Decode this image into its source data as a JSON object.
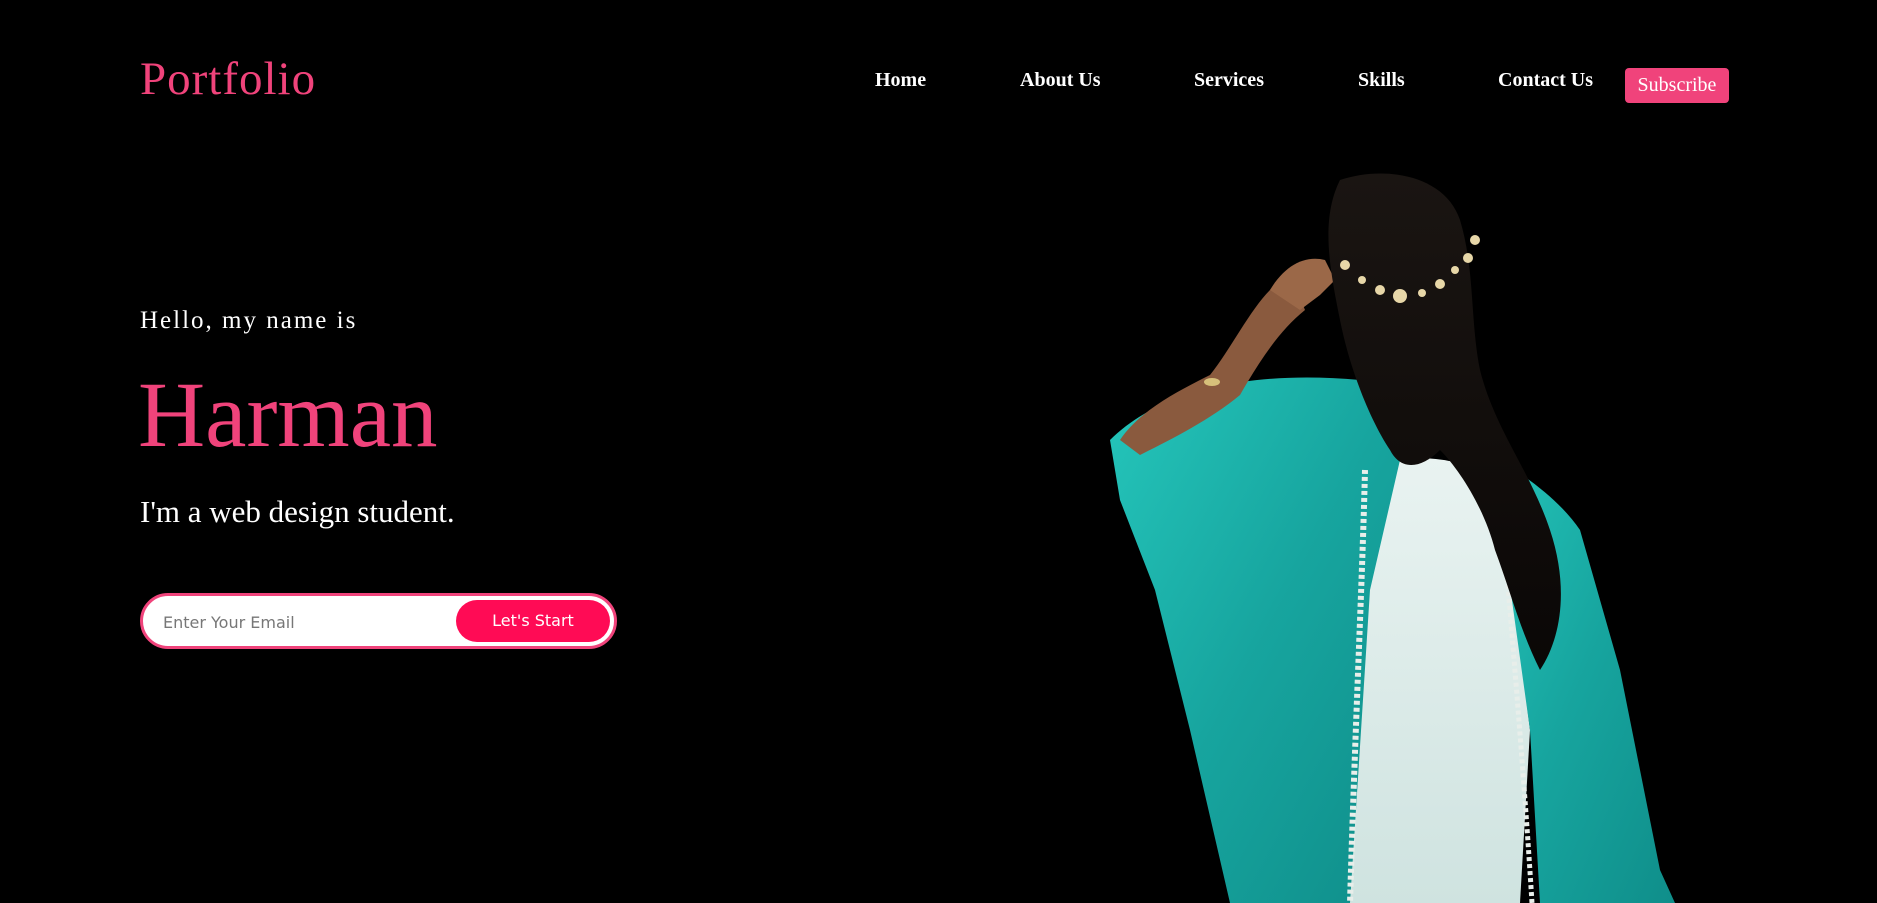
{
  "header": {
    "logo": "Portfolio",
    "nav": [
      {
        "label": "Home"
      },
      {
        "label": "About Us"
      },
      {
        "label": "Services"
      },
      {
        "label": "Skills"
      },
      {
        "label": "Contact Us"
      }
    ],
    "subscribe_label": "Subscribe"
  },
  "hero": {
    "greeting": "Hello, my name is",
    "name": "Harman",
    "tagline": "I'm a web design student.",
    "email_placeholder": "Enter Your Email",
    "email_value": "",
    "cta_label": "Let's Start",
    "image_subject": "woman-in-teal-dupatta-photo"
  },
  "colors": {
    "background": "#000000",
    "accent": "#f0437b",
    "cta": "#ff0b55",
    "text": "#ffffff",
    "dupatta": "#1fb9b0"
  }
}
